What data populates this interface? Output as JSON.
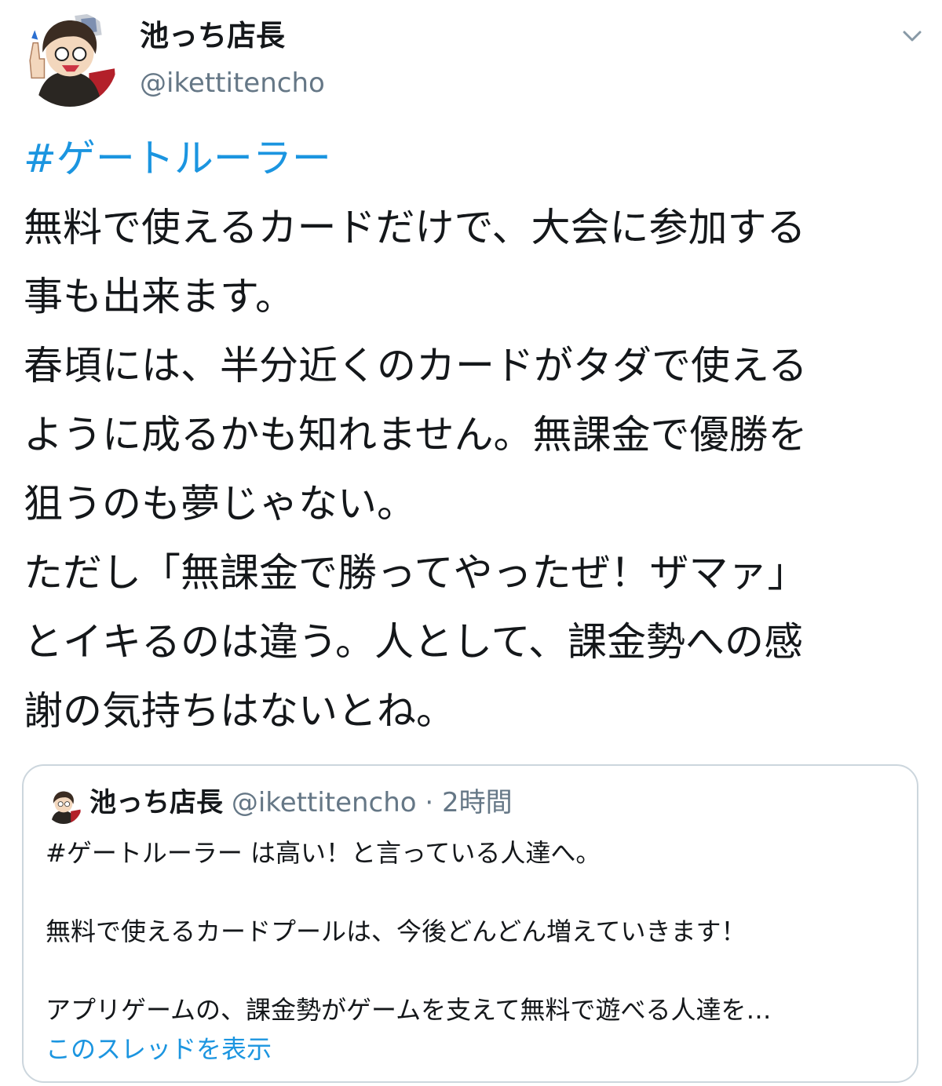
{
  "author": {
    "display_name": "池っち店長",
    "handle": "@ikettitencho",
    "avatar_icon": "avatar-image"
  },
  "menu": {
    "icon": "chevron-down-icon"
  },
  "tweet": {
    "hashtag": "#ゲートルーラー",
    "lines": [
      "無料で使えるカードだけで、大会に参加する",
      "事も出来ます。",
      "春頃には、半分近くのカードがタダで使える",
      "ように成るかも知れません。無課金で優勝を",
      "狙うのも夢じゃない。",
      "ただし「無課金で勝ってやったぜ！ザマァ」",
      "とイキるのは違う。人として、課金勢への感",
      "謝の気持ちはないとね。"
    ]
  },
  "quote": {
    "display_name": "池っち店長",
    "handle": "@ikettitencho",
    "separator": "·",
    "time": "2時間",
    "line1": "#ゲートルーラー は高い！と言っている人達へ。",
    "line2": "無料で使えるカードプールは、今後どんどん増えていきます！",
    "line3": "アプリゲームの、課金勢がゲームを支えて無料で遊べる人達を…",
    "show_thread": "このスレッドを表示"
  },
  "colors": {
    "link": "#1b95e0",
    "text": "#14171a",
    "secondary": "#657786",
    "border": "#ccd6dd"
  }
}
